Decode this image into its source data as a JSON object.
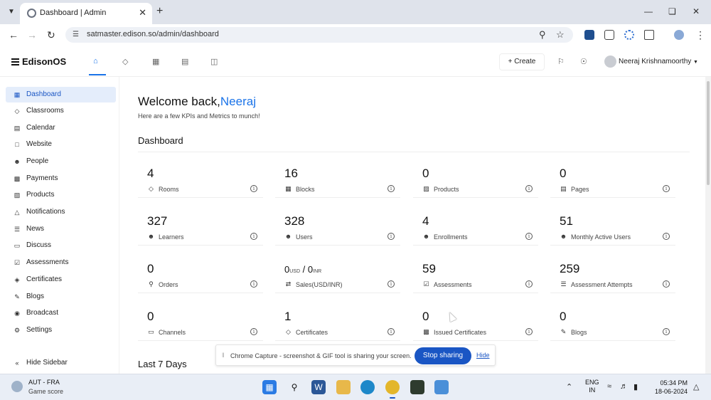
{
  "browser": {
    "tab_title": "Dashboard | Admin",
    "url": "satmaster.edison.so/admin/dashboard"
  },
  "header": {
    "logo_text": "EdisonOS",
    "create_label": "Create",
    "user_name": "Neeraj Krishnamoorthy"
  },
  "sidebar": {
    "items": [
      {
        "label": "Dashboard",
        "icon": "grid-icon"
      },
      {
        "label": "Classrooms",
        "icon": "layers-icon"
      },
      {
        "label": "Calendar",
        "icon": "calendar-icon"
      },
      {
        "label": "Website",
        "icon": "website-icon"
      },
      {
        "label": "People",
        "icon": "people-icon"
      },
      {
        "label": "Payments",
        "icon": "payments-icon"
      },
      {
        "label": "Products",
        "icon": "products-icon"
      },
      {
        "label": "Notifications",
        "icon": "bell-icon"
      },
      {
        "label": "News",
        "icon": "news-icon"
      },
      {
        "label": "Discuss",
        "icon": "discuss-icon"
      },
      {
        "label": "Assessments",
        "icon": "assessments-icon"
      },
      {
        "label": "Certificates",
        "icon": "certificate-icon"
      },
      {
        "label": "Blogs",
        "icon": "blogs-icon"
      },
      {
        "label": "Broadcast",
        "icon": "broadcast-icon"
      },
      {
        "label": "Settings",
        "icon": "gear-icon"
      }
    ],
    "hide_label": "Hide Sidebar"
  },
  "main": {
    "welcome": "Welcome back,",
    "user_first_name": "Neeraj",
    "subtitle": "Here are a few KPIs and Metrics to munch!",
    "section_title": "Dashboard",
    "kpis": [
      {
        "value": "4",
        "label": "Rooms"
      },
      {
        "value": "16",
        "label": "Blocks"
      },
      {
        "value": "0",
        "label": "Products"
      },
      {
        "value": "0",
        "label": "Pages"
      },
      {
        "value": "327",
        "label": "Learners"
      },
      {
        "value": "328",
        "label": "Users"
      },
      {
        "value": "4",
        "label": "Enrollments"
      },
      {
        "value": "51",
        "label": "Monthly Active Users"
      },
      {
        "value": "0",
        "label": "Orders"
      },
      {
        "value_usd": "0",
        "unit_usd": "USD",
        "separator": "/",
        "value_inr": "0",
        "unit_inr": "INR",
        "label": "Sales(USD/INR)"
      },
      {
        "value": "59",
        "label": "Assessments"
      },
      {
        "value": "259",
        "label": "Assessment Attempts"
      },
      {
        "value": "0",
        "label": "Channels"
      },
      {
        "value": "1",
        "label": "Certificates"
      },
      {
        "value": "0",
        "label": "Issued Certificates"
      },
      {
        "value": "0",
        "label": "Blogs"
      }
    ],
    "last7_title": "Last 7 Days"
  },
  "share_banner": {
    "message": "Chrome Capture - screenshot & GIF tool is sharing your screen.",
    "stop_label": "Stop sharing",
    "hide_label": "Hide"
  },
  "taskbar": {
    "weather_title": "AUT - FRA",
    "weather_sub": "Game score",
    "lang_line1": "ENG",
    "lang_line2": "IN",
    "time": "05:34 PM",
    "date": "18-06-2024"
  },
  "colors": {
    "accent": "#1a73e8",
    "active_bg": "#e4edfb",
    "stop_button": "#1a56c4"
  }
}
